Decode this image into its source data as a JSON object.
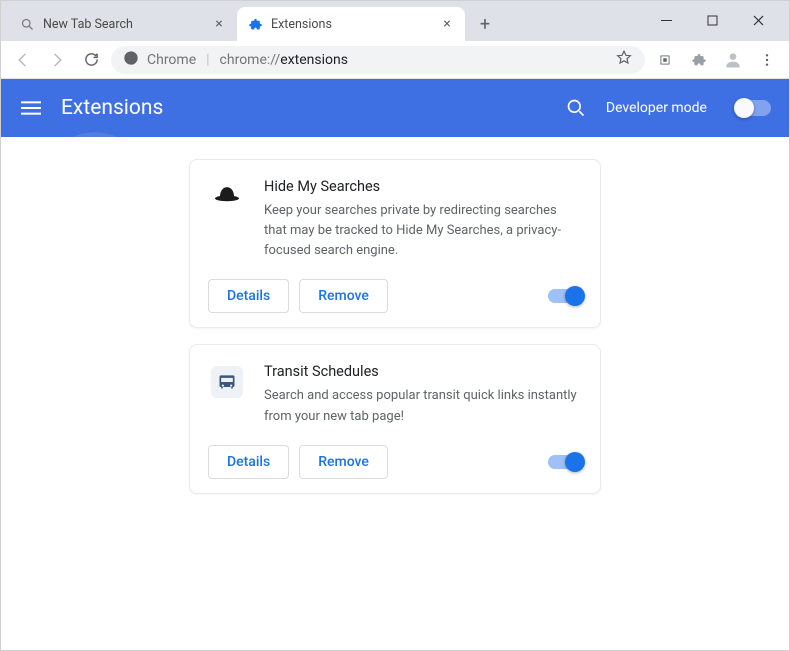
{
  "window": {
    "tabs": [
      {
        "title": "New Tab Search",
        "favicon": "search-icon",
        "active": false
      },
      {
        "title": "Extensions",
        "favicon": "puzzle-icon",
        "active": true
      }
    ]
  },
  "address": {
    "secure_label": "Chrome",
    "url_prefix": "chrome://",
    "url_path": "extensions"
  },
  "header": {
    "title": "Extensions",
    "dev_mode_label": "Developer mode",
    "dev_mode_on": false
  },
  "extensions": [
    {
      "icon": "incognito-hat-icon",
      "name": "Hide My Searches",
      "description": "Keep your searches private by redirecting searches that may be tracked to Hide My Searches, a privacy-focused search engine.",
      "details_label": "Details",
      "remove_label": "Remove",
      "enabled": true
    },
    {
      "icon": "bus-icon",
      "name": "Transit Schedules",
      "description": "Search and access popular transit quick links instantly from your new tab page!",
      "details_label": "Details",
      "remove_label": "Remove",
      "enabled": true
    }
  ]
}
